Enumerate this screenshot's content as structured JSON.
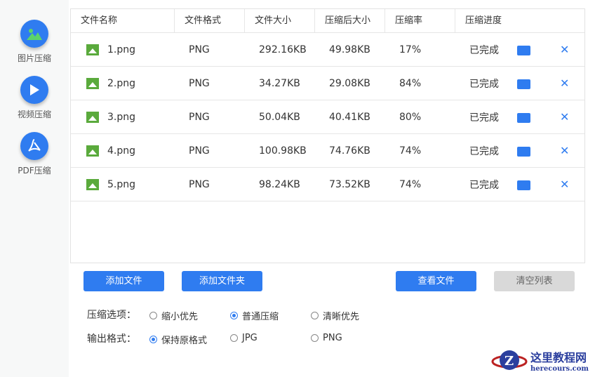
{
  "sidebar": {
    "items": [
      {
        "label": "图片压缩"
      },
      {
        "label": "视频压缩"
      },
      {
        "label": "PDF压缩"
      }
    ]
  },
  "table": {
    "headers": [
      "文件名称",
      "文件格式",
      "文件大小",
      "压缩后大小",
      "压缩率",
      "压缩进度"
    ],
    "rows": [
      {
        "name": "1.png",
        "format": "PNG",
        "size": "292.16KB",
        "compressed": "49.98KB",
        "rate": "17%",
        "status": "已完成"
      },
      {
        "name": "2.png",
        "format": "PNG",
        "size": "34.27KB",
        "compressed": "29.08KB",
        "rate": "84%",
        "status": "已完成"
      },
      {
        "name": "3.png",
        "format": "PNG",
        "size": "50.04KB",
        "compressed": "40.41KB",
        "rate": "80%",
        "status": "已完成"
      },
      {
        "name": "4.png",
        "format": "PNG",
        "size": "100.98KB",
        "compressed": "74.76KB",
        "rate": "74%",
        "status": "已完成"
      },
      {
        "name": "5.png",
        "format": "PNG",
        "size": "98.24KB",
        "compressed": "73.52KB",
        "rate": "74%",
        "status": "已完成"
      }
    ]
  },
  "buttons": {
    "add_file": "添加文件",
    "add_folder": "添加文件夹",
    "view_files": "查看文件",
    "clear_list": "清空列表"
  },
  "options": {
    "compress_label": "压缩选项：",
    "compress": [
      "缩小优先",
      "普通压缩",
      "清晰优先"
    ],
    "compress_selected": 1,
    "format_label": "输出格式：",
    "format": [
      "保持原格式",
      "JPG",
      "PNG"
    ],
    "format_selected": 0
  },
  "watermark": {
    "title": "这里教程网",
    "url": "herecours.com"
  },
  "colors": {
    "accent": "#2f7cf0"
  }
}
